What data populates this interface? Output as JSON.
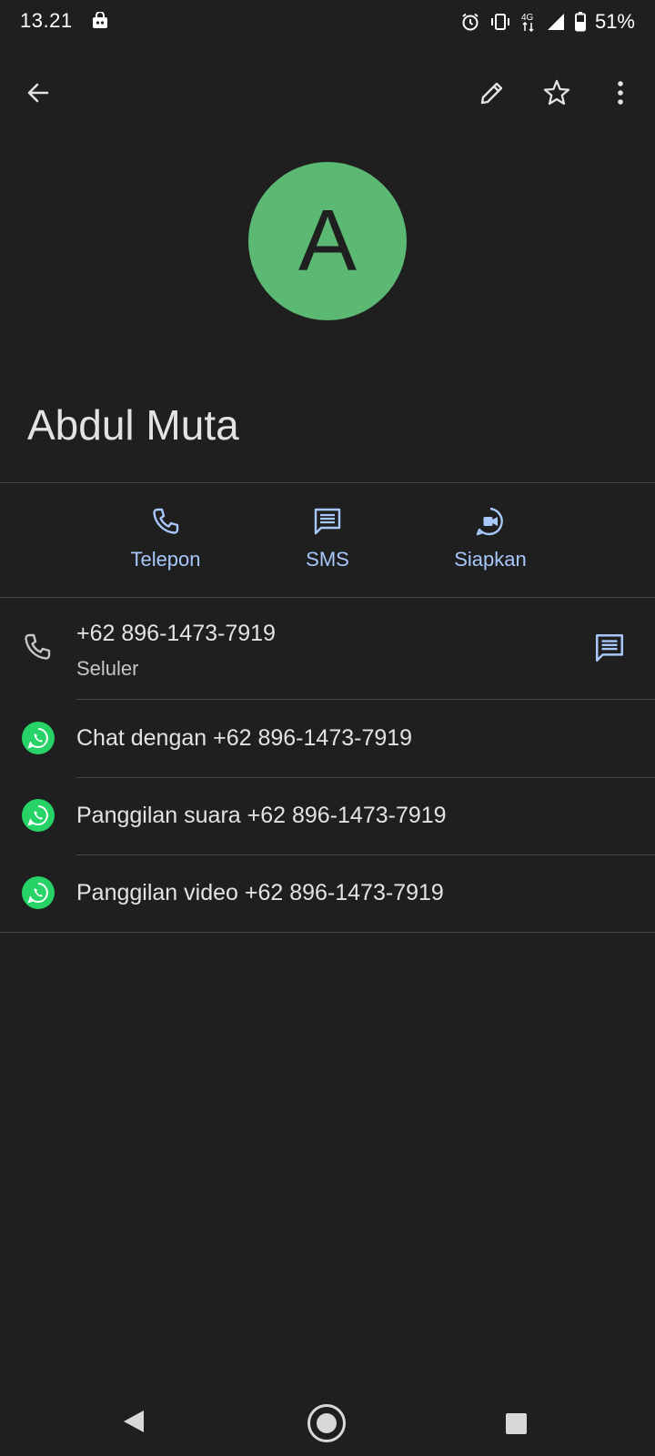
{
  "status_bar": {
    "time": "13.21",
    "network": "4G",
    "battery": "51%"
  },
  "app_bar": {
    "icons": [
      "back-arrow-icon",
      "edit-pencil-icon",
      "star-outline-icon",
      "more-vert-icon"
    ]
  },
  "contact": {
    "avatar_letter": "A",
    "avatar_color": "#5bb974",
    "name": "Abdul Muta"
  },
  "quick_actions": [
    {
      "label": "Telepon",
      "icon": "phone-icon"
    },
    {
      "label": "SMS",
      "icon": "message-icon"
    },
    {
      "label": "Siapkan",
      "icon": "video-call-icon"
    }
  ],
  "phone": {
    "number": "+62 896-1473-7919",
    "type": "Seluler"
  },
  "whatsapp_actions": [
    {
      "label": "Chat dengan +62 896-1473-7919"
    },
    {
      "label": "Panggilan suara +62 896-1473-7919"
    },
    {
      "label": "Panggilan video +62 896-1473-7919"
    }
  ],
  "colors": {
    "background": "#1f1f1f",
    "accent": "#a8c7fa",
    "whatsapp": "#25d366"
  }
}
